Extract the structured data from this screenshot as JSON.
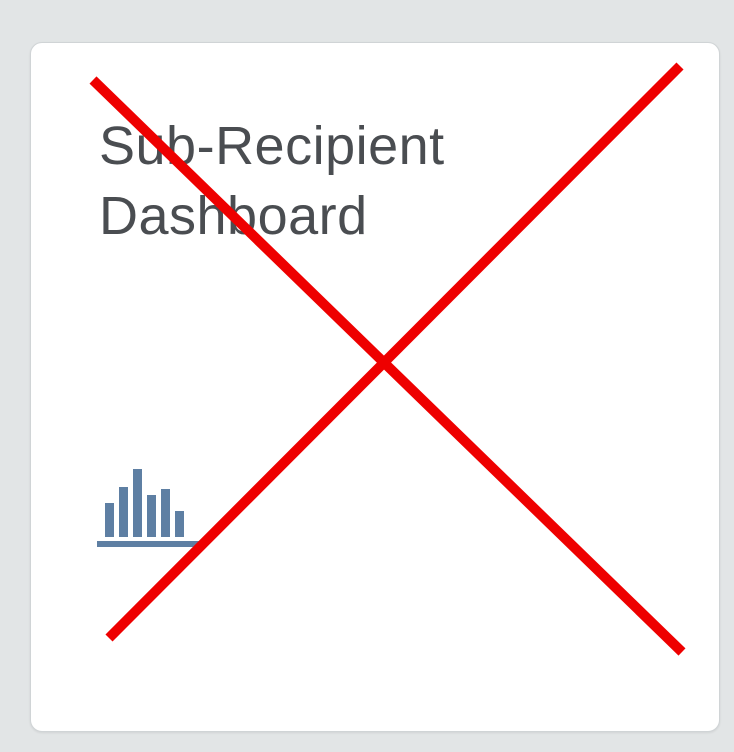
{
  "tile": {
    "title_line1": "Sub-Recipient",
    "title_line2": "Dashboard",
    "icon": "bar-chart-icon"
  },
  "overlay": {
    "icon": "red-x-cross-icon",
    "color": "#ee0000"
  },
  "colors": {
    "page_background": "#e2e5e6",
    "tile_background": "#ffffff",
    "title_text": "#4a4d51",
    "icon_fill": "#5e7fa3"
  }
}
